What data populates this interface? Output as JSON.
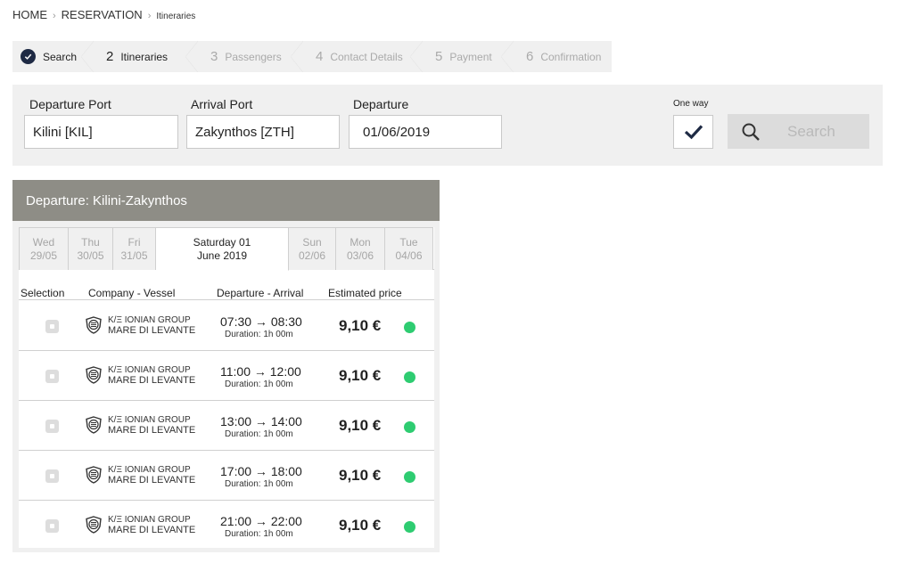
{
  "breadcrumb": {
    "home": "HOME",
    "reservation": "RESERVATION",
    "current": "Itineraries"
  },
  "steps": [
    {
      "num": "",
      "label": "Search",
      "state": "done"
    },
    {
      "num": "2",
      "label": "Itineraries",
      "state": "active"
    },
    {
      "num": "3",
      "label": "Passengers",
      "state": "inactive"
    },
    {
      "num": "4",
      "label": "Contact Details",
      "state": "inactive"
    },
    {
      "num": "5",
      "label": "Payment",
      "state": "inactive"
    },
    {
      "num": "6",
      "label": "Confirmation",
      "state": "inactive"
    }
  ],
  "search": {
    "departure_port_label": "Departure Port",
    "departure_port_value": "Kilini  [KIL]",
    "arrival_port_label": "Arrival Port",
    "arrival_port_value": "Zakynthos  [ZTH]",
    "departure_label": "Departure",
    "departure_value": "01/06/2019",
    "one_way_label": "One way",
    "one_way_checked": true,
    "search_button": "Search"
  },
  "departure_card": {
    "title": "Departure: Kilini-Zakynthos",
    "dates": [
      {
        "day": "Wed",
        "date": "29/05"
      },
      {
        "day": "Thu",
        "date": "30/05"
      },
      {
        "day": "Fri",
        "date": "31/05"
      },
      {
        "day": "Saturday 01",
        "date": "June 2019",
        "selected": true
      },
      {
        "day": "Sun",
        "date": "02/06"
      },
      {
        "day": "Mon",
        "date": "03/06"
      },
      {
        "day": "Tue",
        "date": "04/06"
      }
    ],
    "columns": {
      "selection": "Selection",
      "company": "Company - Vessel",
      "departure_arrival": "Departure - Arrival",
      "price": "Estimated price"
    },
    "rows": [
      {
        "company": "K/Ξ IONIAN GROUP",
        "vessel": "MARE DI LEVANTE",
        "times": "07:30 → 08:30",
        "duration": "Duration: 1h 00m",
        "price": "9,10 €"
      },
      {
        "company": "K/Ξ IONIAN GROUP",
        "vessel": "MARE DI LEVANTE",
        "times": "11:00 → 12:00",
        "duration": "Duration: 1h 00m",
        "price": "9,10 €"
      },
      {
        "company": "K/Ξ IONIAN GROUP",
        "vessel": "MARE DI LEVANTE",
        "times": "13:00 → 14:00",
        "duration": "Duration: 1h 00m",
        "price": "9,10 €"
      },
      {
        "company": "K/Ξ IONIAN GROUP",
        "vessel": "MARE DI LEVANTE",
        "times": "17:00 → 18:00",
        "duration": "Duration: 1h 00m",
        "price": "9,10 €"
      },
      {
        "company": "K/Ξ IONIAN GROUP",
        "vessel": "MARE DI LEVANTE",
        "times": "21:00 → 22:00",
        "duration": "Duration: 1h 00m",
        "price": "9,10 €"
      }
    ]
  },
  "colors": {
    "header_bg": "#8e8d86",
    "step_check": "#1e2a44",
    "availability": "#2ecc71"
  },
  "icons": {
    "step_done": "check-icon",
    "search": "magnifier-icon",
    "checkbox": "check-icon",
    "company_logo": "ionian-group-logo-icon",
    "availability": "green-dot-icon"
  }
}
